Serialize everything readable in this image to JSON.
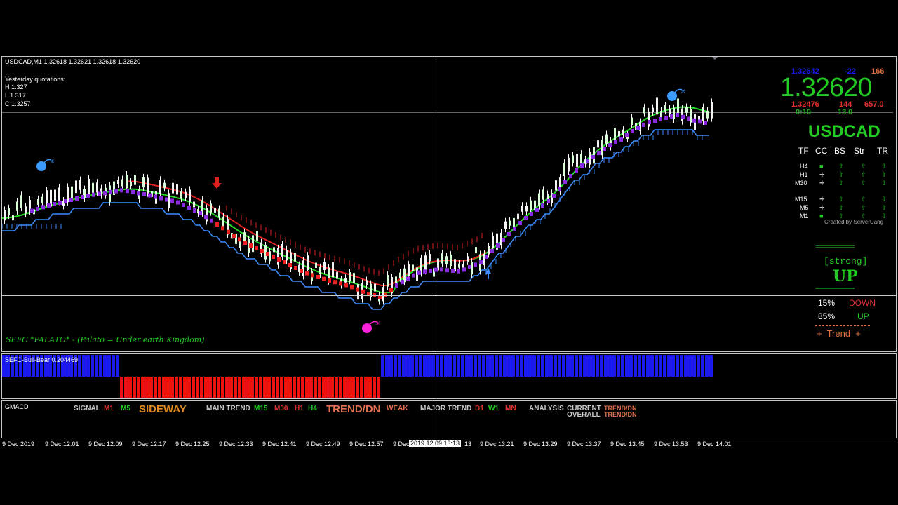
{
  "chart_header": {
    "symbol_info": "USDCAD,M1  1.32618 1.32621 1.32618 1.32620",
    "yesterday_title": "Yesterday quotations:",
    "yesterday_high": "H 1.327",
    "yesterday_low": "L 1.317",
    "yesterday_close": "C 1.3257",
    "watermark": "SEFC *PALATO* - (Palato = Under earth Kingdom)"
  },
  "price_panel": {
    "top_price": "1.32642",
    "top_diff": "-22",
    "top_pips": "166",
    "big_price": "1.32620",
    "low_price": "1.32476",
    "low_diff": "144",
    "low_value": "657.0",
    "timer": "0:10",
    "timer_value": "13.0",
    "symbol": "USDCAD",
    "col_headers": [
      "TF",
      "CC",
      "BS",
      "Str",
      "TR"
    ],
    "timeframes": [
      "H4",
      "H1",
      "M30",
      "M15",
      "M5",
      "M1"
    ],
    "credit": "Created by ServerUang",
    "dashes": "==================",
    "strength_label": "[strong]",
    "direction": "UP",
    "down_pct": "15%",
    "down_label": "DOWN",
    "up_pct": "85%",
    "up_label": "UP",
    "trend_label": "+  Trend  +",
    "colors": {
      "up": "#22cc22",
      "down": "#e03030",
      "blue": "#1a1aee",
      "accent": "#e07040"
    }
  },
  "bull_bear": {
    "label": "SEFC-Bull-Bear 0.204469",
    "value": 0.204469
  },
  "gmacd": {
    "label": "GMACD",
    "signal_label": "SIGNAL",
    "signal_m1": "M1",
    "signal_m5": "M5",
    "signal_state": "SIDEWAY",
    "main_label": "MAIN TREND",
    "main_m15": "M15",
    "main_m30": "M30",
    "main_h1": "H1",
    "main_h4": "H4",
    "main_state": "TREND/DN",
    "main_weak": "WEAK",
    "major_label": "MAJOR TREND",
    "major_d1": "D1",
    "major_w1": "W1",
    "major_mn": "MN",
    "analysis_label": "ANALYSIS",
    "current_label": "CURRENT",
    "current_state": "TREND/DN",
    "overall_label": "OVERALL",
    "overall_state": "TREND/DN"
  },
  "time_axis": {
    "labels": [
      "9 Dec 2019",
      "9 Dec 12:01",
      "9 Dec 12:09",
      "9 Dec 12:17",
      "9 Dec 12:25",
      "9 Dec 12:33",
      "9 Dec 12:41",
      "9 Dec 12:49",
      "9 Dec 12:57",
      "9 Dec",
      "13",
      "9 Dec 13:21",
      "9 Dec 13:29",
      "9 Dec 13:37",
      "9 Dec 13:45",
      "9 Dec 13:53",
      "9 Dec 14:01"
    ],
    "crosshair_time": "2019.12.09 13:13"
  }
}
